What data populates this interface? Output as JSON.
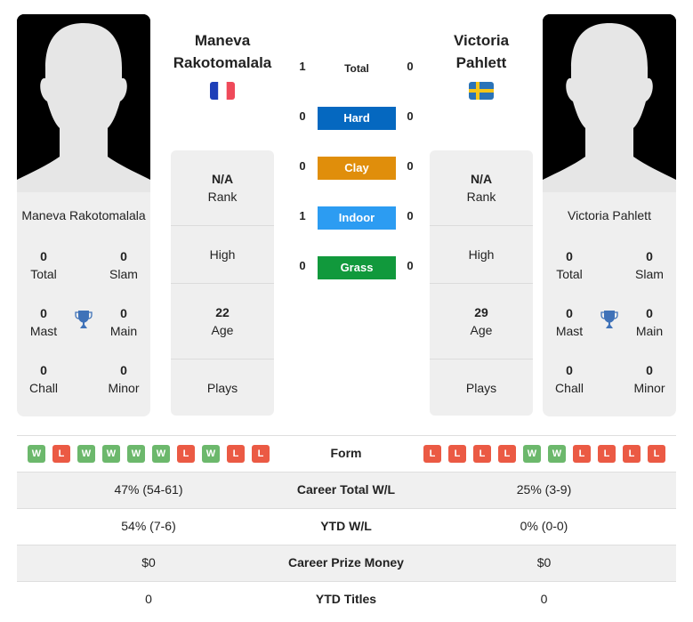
{
  "colors": {
    "hard": "#0568c0",
    "clay": "#e08e0b",
    "indoor": "#2c9cf2",
    "grass": "#11993c",
    "win": "#6cb86c",
    "loss": "#eb5a44",
    "trophy": "#3f72b8"
  },
  "player1": {
    "name_line1": "Maneva",
    "name_line2": "Rakotomalala",
    "full_name": "Maneva Rakotomalala",
    "country": "France",
    "titles": {
      "total": "0",
      "total_label": "Total",
      "slam": "0",
      "slam_label": "Slam",
      "mast": "0",
      "mast_label": "Mast",
      "main": "0",
      "main_label": "Main",
      "chall": "0",
      "chall_label": "Chall",
      "minor": "0",
      "minor_label": "Minor"
    },
    "info": {
      "rank": "N/A",
      "rank_label": "Rank",
      "high_label": "High",
      "age": "22",
      "age_label": "Age",
      "plays_label": "Plays"
    },
    "form": [
      "W",
      "L",
      "W",
      "W",
      "W",
      "W",
      "L",
      "W",
      "L",
      "L"
    ]
  },
  "player2": {
    "name_line1": "Victoria",
    "name_line2": "Pahlett",
    "full_name": "Victoria Pahlett",
    "country": "Sweden",
    "titles": {
      "total": "0",
      "total_label": "Total",
      "slam": "0",
      "slam_label": "Slam",
      "mast": "0",
      "mast_label": "Mast",
      "main": "0",
      "main_label": "Main",
      "chall": "0",
      "chall_label": "Chall",
      "minor": "0",
      "minor_label": "Minor"
    },
    "info": {
      "rank": "N/A",
      "rank_label": "Rank",
      "high_label": "High",
      "age": "29",
      "age_label": "Age",
      "plays_label": "Plays"
    },
    "form": [
      "L",
      "L",
      "L",
      "L",
      "W",
      "W",
      "L",
      "L",
      "L",
      "L"
    ]
  },
  "h2h": {
    "total": {
      "label": "Total",
      "p1": "1",
      "p2": "0"
    },
    "hard": {
      "label": "Hard",
      "p1": "0",
      "p2": "0"
    },
    "clay": {
      "label": "Clay",
      "p1": "0",
      "p2": "0"
    },
    "indoor": {
      "label": "Indoor",
      "p1": "1",
      "p2": "0"
    },
    "grass": {
      "label": "Grass",
      "p1": "0",
      "p2": "0"
    }
  },
  "stats": {
    "form_label": "Form",
    "rows": [
      {
        "label": "Career Total W/L",
        "p1": "47% (54-61)",
        "p2": "25% (3-9)"
      },
      {
        "label": "YTD W/L",
        "p1": "54% (7-6)",
        "p2": "0% (0-0)"
      },
      {
        "label": "Career Prize Money",
        "p1": "$0",
        "p2": "$0"
      },
      {
        "label": "YTD Titles",
        "p1": "0",
        "p2": "0"
      }
    ]
  }
}
